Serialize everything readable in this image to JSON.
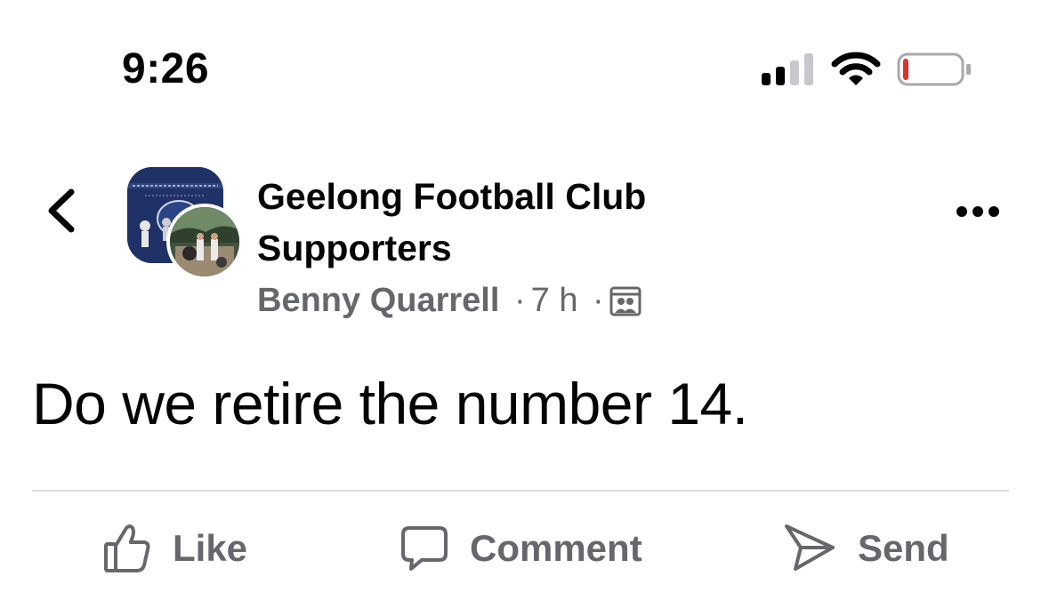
{
  "status_bar": {
    "time": "9:26",
    "battery_level": 0.08,
    "battery_color": "#e0302d",
    "signal_bars_active": 2,
    "signal_bars_total": 4
  },
  "post": {
    "group_name": "Geelong Football Club Supporters",
    "author": "Benny Quarrell",
    "time_ago": "7 h",
    "separator": "·",
    "privacy": "group-members-icon",
    "text": "Do we retire the number 14."
  },
  "actions": {
    "like_label": "Like",
    "comment_label": "Comment",
    "send_label": "Send"
  },
  "colors": {
    "text_primary": "#050505",
    "text_secondary": "#65676b",
    "divider": "#dadde1"
  }
}
